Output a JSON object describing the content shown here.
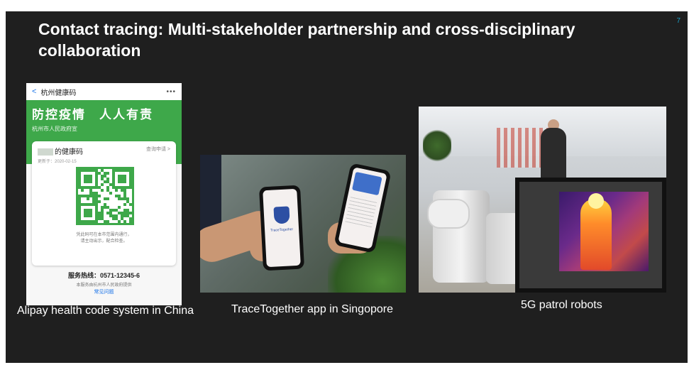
{
  "slide": {
    "page_number": "7",
    "title": "Contact tracing: Multi-stakeholder partnership and cross-disciplinary collaboration"
  },
  "alipay": {
    "back_glyph": "<",
    "app_title": "杭州健康码",
    "more_glyph": "•••",
    "slogan": "防控疫情　人人有责",
    "government": "杭州市人民政府宣",
    "code_title": "的健康码",
    "apply_link": "查询申请 >",
    "update_date": "更新于：2020-02-15",
    "note_line1": "凭此码可在本市范围内通行，",
    "note_line2": "请主动出示，配合检查。",
    "hotline": "服务热线：0571-12345-6",
    "provider": "本服务由杭州市人民政府提供",
    "faq": "常见问题",
    "caption": "Alipay health code system in China"
  },
  "tracetogether": {
    "brand": "TraceTogether",
    "caption": "TraceTogether app in Singopore"
  },
  "robots": {
    "caption": "5G patrol robots"
  },
  "colors": {
    "slide_bg": "#1f1f1f",
    "alipay_green": "#3ea84a",
    "page_number": "#1aa0c8",
    "tracetogether_blue": "#2d4fa3"
  }
}
